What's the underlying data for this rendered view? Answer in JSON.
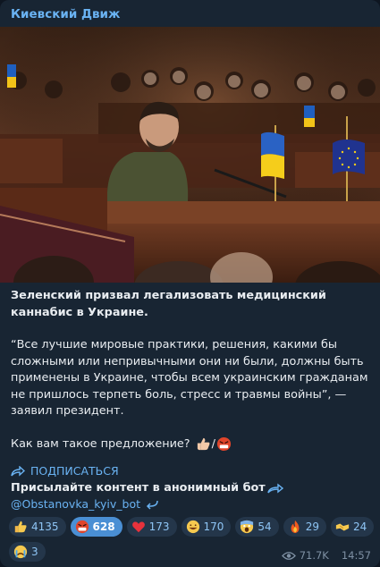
{
  "channel": {
    "name": "Киевский Движ"
  },
  "post": {
    "headline": "Зеленский призвал легализовать медицинский каннабис в Украине.",
    "quote": "“Все лучшие мировые практики, решения, какими бы сложными или непривычными они ни были, должны быть применены в Украине, чтобы всем украинским гражданам не пришлось терпеть боль, стресс и травмы войны”, — заявил президент.",
    "question": "Как вам такое предложение?",
    "question_sep": "/",
    "subscribe_label": "ПОДПИСАТЬСЯ",
    "promo_text": "Присылайте контент в анонимный бот",
    "bot_handle": "@Obstanovka_kyiv_bot"
  },
  "reactions": [
    {
      "icon": "thumbs-up-icon",
      "count": "4135",
      "active": false
    },
    {
      "icon": "angry-face-icon",
      "count": "628",
      "active": true
    },
    {
      "icon": "heart-icon",
      "count": "173",
      "active": false
    },
    {
      "icon": "grinning-face-icon",
      "count": "170",
      "active": false
    },
    {
      "icon": "screaming-face-icon",
      "count": "54",
      "active": false
    },
    {
      "icon": "fire-icon",
      "count": "29",
      "active": false
    },
    {
      "icon": "handshake-icon",
      "count": "24",
      "active": false
    },
    {
      "icon": "crying-face-icon",
      "count": "3",
      "active": false
    }
  ],
  "meta": {
    "views": "71.7K",
    "time": "14:57"
  },
  "colors": {
    "accent": "#6ab3f3",
    "bubble": "#182533",
    "active_chip": "#4a8fd4"
  }
}
